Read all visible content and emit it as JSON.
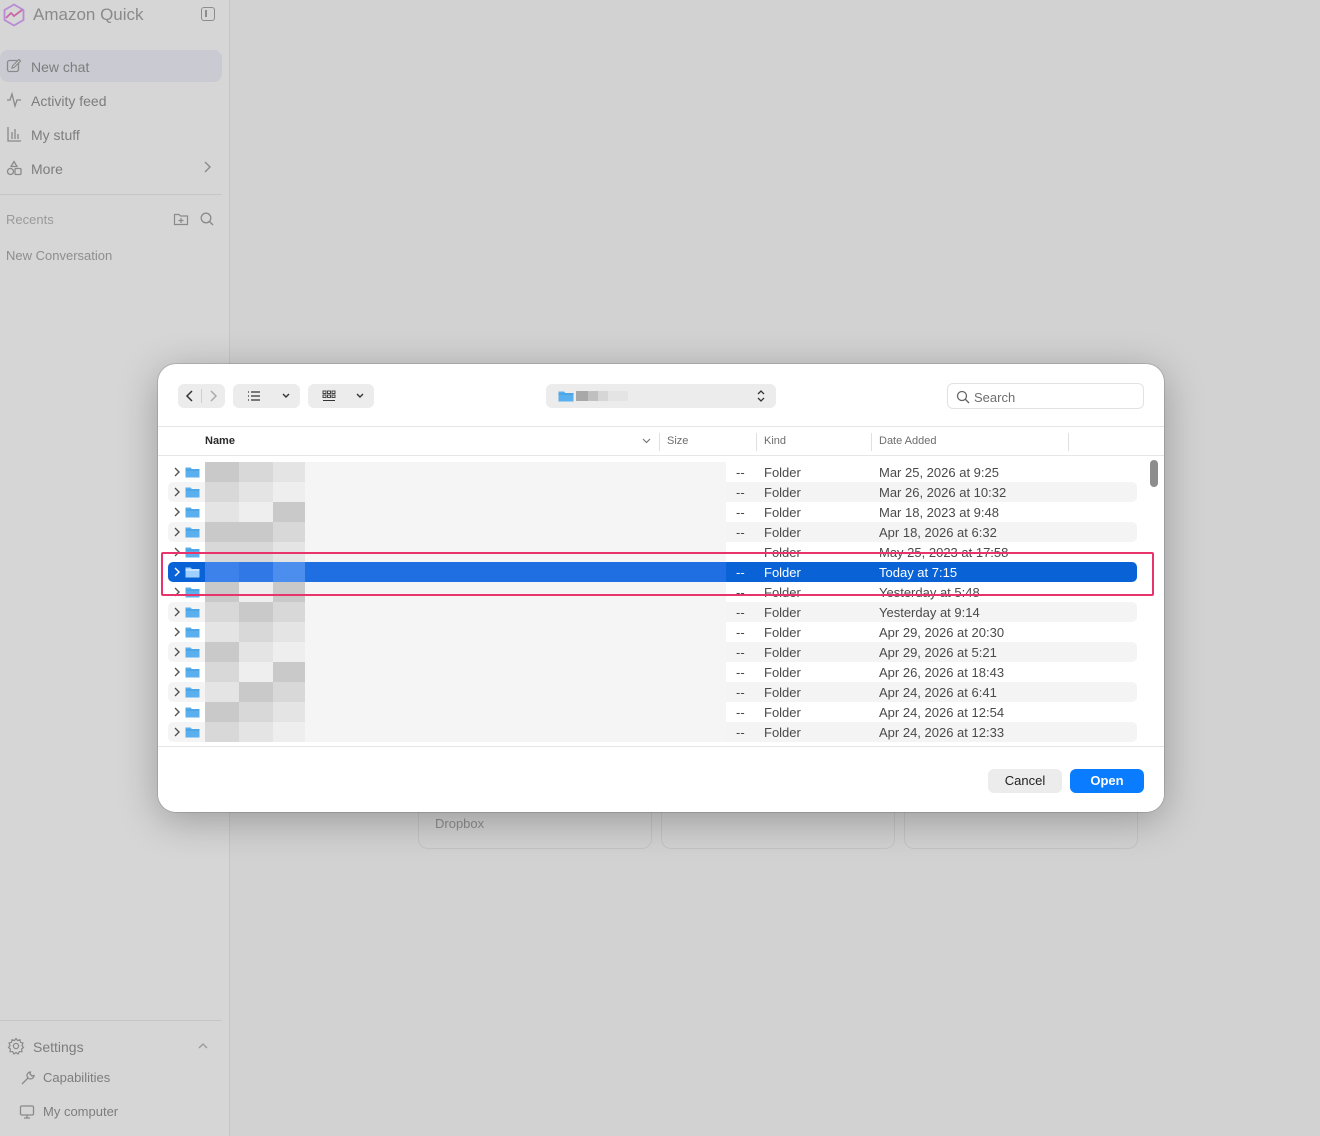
{
  "app": {
    "name": "Amazon Quick"
  },
  "sidebar": {
    "nav": [
      {
        "label": "New chat",
        "icon": "pencil-square-icon",
        "active": true
      },
      {
        "label": "Activity feed",
        "icon": "activity-pulse-icon",
        "active": false
      },
      {
        "label": "My stuff",
        "icon": "bar-chart-icon",
        "active": false
      },
      {
        "label": "More",
        "icon": "shapes-icon",
        "active": false
      }
    ],
    "recents_label": "Recents",
    "recents": [
      "New Conversation"
    ],
    "footer": {
      "settings_label": "Settings",
      "capabilities_label": "Capabilities",
      "my_computer_label": "My computer"
    }
  },
  "background": {
    "cards": [
      "Dropbox",
      "",
      ""
    ]
  },
  "dialog": {
    "search_placeholder": "Search",
    "columns": {
      "name": "Name",
      "size": "Size",
      "kind": "Kind",
      "date": "Date Added"
    },
    "rows": [
      {
        "size": "--",
        "kind": "Folder",
        "date": "Mar 25, 2026 at 9:25"
      },
      {
        "size": "--",
        "kind": "Folder",
        "date": "Mar 26, 2026 at 10:32"
      },
      {
        "size": "--",
        "kind": "Folder",
        "date": "Mar 18, 2023 at 9:48"
      },
      {
        "size": "--",
        "kind": "Folder",
        "date": "Apr 18, 2026 at 6:32"
      },
      {
        "size": "--",
        "kind": "Folder",
        "date": "May 25, 2023 at 17:58"
      },
      {
        "size": "--",
        "kind": "Folder",
        "date": "Today at 7:15",
        "selected": true
      },
      {
        "size": "--",
        "kind": "Folder",
        "date": "Yesterday at 5:48"
      },
      {
        "size": "--",
        "kind": "Folder",
        "date": "Yesterday at 9:14"
      },
      {
        "size": "--",
        "kind": "Folder",
        "date": "Apr 29, 2026 at 20:30"
      },
      {
        "size": "--",
        "kind": "Folder",
        "date": "Apr 29, 2026 at 5:21"
      },
      {
        "size": "--",
        "kind": "Folder",
        "date": "Apr 26, 2026 at 18:43"
      },
      {
        "size": "--",
        "kind": "Folder",
        "date": "Apr 24, 2026 at 6:41"
      },
      {
        "size": "--",
        "kind": "Folder",
        "date": "Apr 24, 2026 at 12:54"
      },
      {
        "size": "--",
        "kind": "Folder",
        "date": "Apr 24, 2026 at 12:33"
      }
    ],
    "cancel_label": "Cancel",
    "open_label": "Open"
  },
  "colors": {
    "selection": "#0a63d6",
    "open_button": "#0a7cff",
    "highlight": "#e8336c",
    "folder": "#5ab0ee"
  }
}
